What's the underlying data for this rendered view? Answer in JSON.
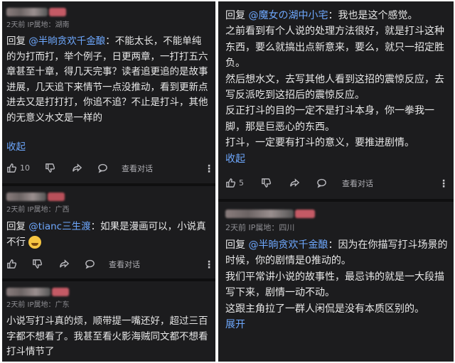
{
  "left": {
    "c1": {
      "meta": "2天前 IP属地：湖南",
      "reply": "回复 ",
      "mention": "@半晌贪欢千金酿",
      "text": "：不能太长，不能单纯的为打而打，举个例子，日更两章，一打打五六章甚至十章，得几天完事？读者追更追的是故事进展，几天追下来情节一点没推动，看到更新点进去又是打打打，你追不追？不止是打斗，其他的无意义水文是一样的",
      "collapse": "收起",
      "likes": "10",
      "view_conversation": "查看对话"
    },
    "c2": {
      "meta": "2天前 IP属地：广西",
      "reply": "回复 ",
      "mention": "@tianc三生渡",
      "text": "：如果是漫画可以，小说真不行",
      "view_conversation": "查看对话"
    },
    "c3": {
      "meta": "2天前 IP属地：广东",
      "text": "小说写打斗真的烦，顺带提一嘴还好，超过三百字都不想看了。我甚至看火影海贼同文都不想看打斗情节了"
    }
  },
  "right": {
    "c1": {
      "reply": "回复 ",
      "mention": "@魔女の湖中小宅",
      "text_lines": [
        "：我也是这个感觉。",
        "之前看到有个人说的处理方法很好，就是打斗这种东西，要么就搞出点新意来，要么，就只一招定胜负。",
        "然后想水文，去写其他人看到这招的震惊反应，去写反派吃到这招后的震惊反应。",
        "反正打斗的目的一定不是打斗本身，你一拳我一脚，那是巨恶心的东西。",
        "打斗，一定要有打斗的意义，要推进剧情。"
      ],
      "collapse": "收起",
      "likes": "5",
      "view_conversation": "查看对话"
    },
    "c2": {
      "meta": "2天前 IP属地：四川",
      "reply": "回复 ",
      "mention": "@半晌贪欢千金酿",
      "text_lines": [
        "：因为在你描写打斗场景的时候，你的剧情是0推动的。",
        "我们平常讲小说的故事性，最忌讳的就是一大段描写下来，剧情一动不动。",
        "这跟主角拉了一群人闲侃是没有本质区别的。"
      ],
      "expand": "展开"
    }
  },
  "colors": {
    "background": "#1c1c1e",
    "mention": "#6ea8fe",
    "meta": "#8e8e93"
  },
  "icons": [
    "thumbs-up-icon",
    "thumbs-down-icon",
    "share-icon",
    "comment-icon",
    "more-icon"
  ]
}
